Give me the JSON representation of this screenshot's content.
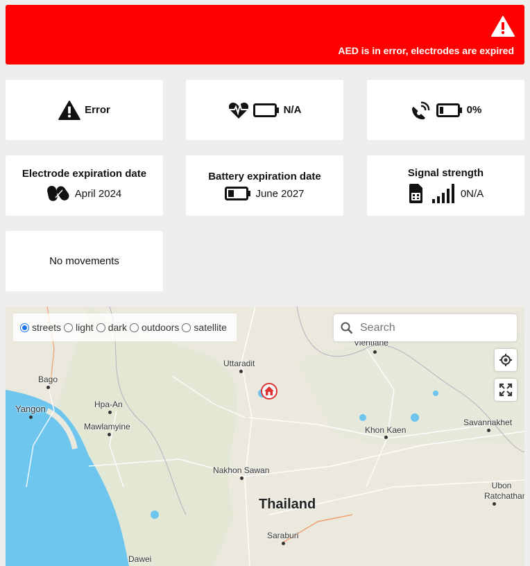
{
  "banner": {
    "message": "AED is in error, electrodes are expired"
  },
  "status": {
    "state": "Error",
    "heart_battery": "N/A",
    "signal_battery": "0%"
  },
  "details": {
    "electrode": {
      "title": "Electrode expiration date",
      "value": "April 2024"
    },
    "battery": {
      "title": "Battery expiration date",
      "value": "June 2027"
    },
    "signal": {
      "title": "Signal strength",
      "value": "0N/A"
    }
  },
  "movements": {
    "text": "No movements"
  },
  "map": {
    "styles": [
      {
        "label": "streets",
        "selected": true
      },
      {
        "label": "light",
        "selected": false
      },
      {
        "label": "dark",
        "selected": false
      },
      {
        "label": "outdoors",
        "selected": false
      },
      {
        "label": "satellite",
        "selected": false
      }
    ],
    "search_placeholder": "Search",
    "country": "Thailand",
    "places": [
      "Vientiane",
      "Uttaradit",
      "Bago",
      "Yangon",
      "Hpa-An",
      "Mawlamyine",
      "Khon Kaen",
      "Savannakhet",
      "Nakhon Sawan",
      "Ubon Ratchathani",
      "Saraburi",
      "Dawei"
    ]
  },
  "colors": {
    "banner": "#ff0000",
    "water": "#6ec6ee",
    "card": "#ffffff"
  }
}
